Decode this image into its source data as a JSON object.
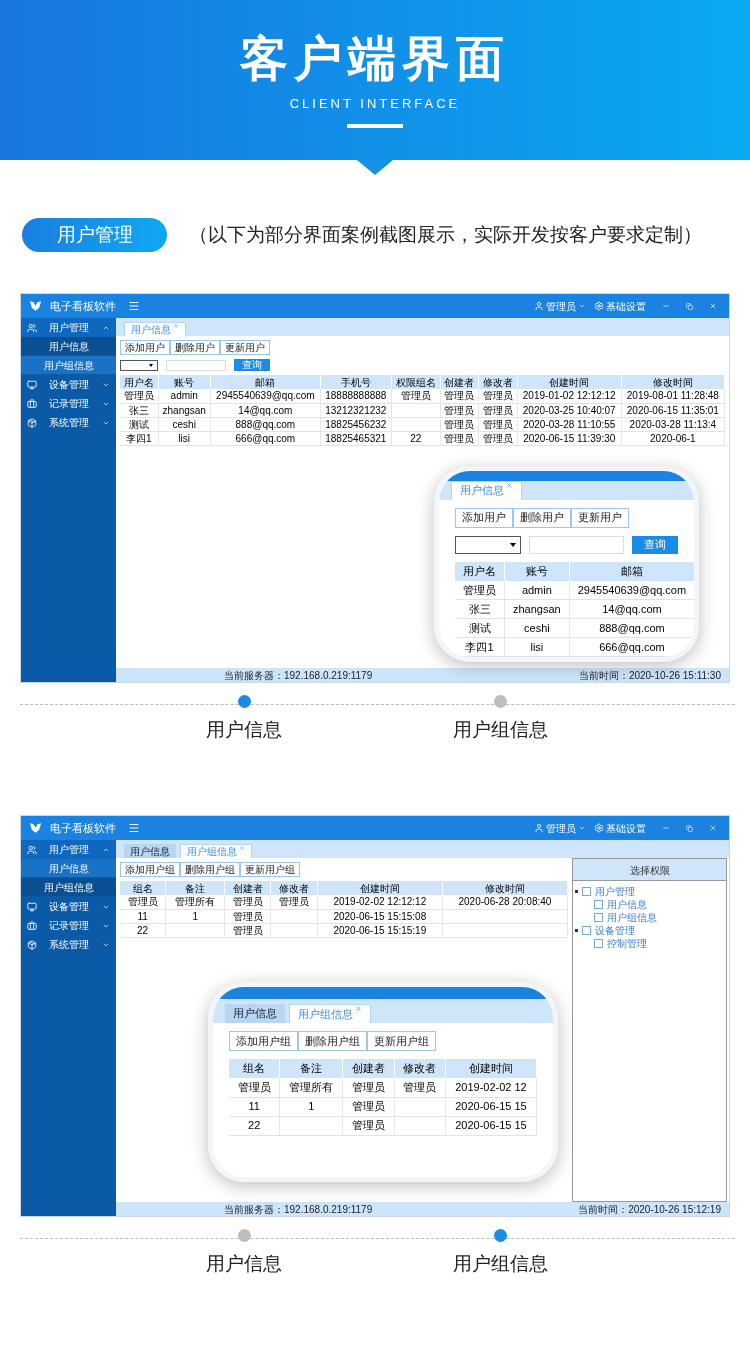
{
  "banner": {
    "title": "客户端界面",
    "subtitle": "CLIENT INTERFACE"
  },
  "section": {
    "label": "用户管理",
    "note": "（以下为部分界面案例截图展示，实际开发按客户要求定制）"
  },
  "screens": [
    {
      "app_title": "电子看板软件",
      "user": "管理员",
      "settings": "基础设置",
      "sidebar": [
        {
          "label": "用户管理",
          "expanded": true,
          "children": [
            {
              "label": "用户信息",
              "selected": true
            },
            {
              "label": "用户组信息",
              "selected": false
            }
          ]
        },
        {
          "label": "设备管理",
          "expanded": false
        },
        {
          "label": "记录管理",
          "expanded": false
        },
        {
          "label": "系统管理",
          "expanded": false
        }
      ],
      "tabs": [
        {
          "label": "用户信息",
          "selected": true
        }
      ],
      "buttons": [
        "添加用户",
        "删除用户",
        "更新用户"
      ],
      "search": {
        "button": "查询"
      },
      "table": {
        "columns": [
          "用户名",
          "账号",
          "邮箱",
          "手机号",
          "权限组名",
          "创建者",
          "修改者",
          "创建时间",
          "修改时间"
        ],
        "rows": [
          [
            "管理员",
            "admin",
            "2945540639@qq.com",
            "18888888888",
            "管理员",
            "管理员",
            "管理员",
            "2019-01-02 12:12:12",
            "2019-08-01 11:28:48"
          ],
          [
            "张三",
            "zhangsan",
            "14@qq.com",
            "13212321232",
            null,
            "管理员",
            "管理员",
            "2020-03-25 10:40:07",
            "2020-06-15 11:35:01"
          ],
          [
            "测试",
            "ceshi",
            "888@qq.com",
            "18825456232",
            null,
            "管理员",
            "管理员",
            "2020-03-28 11:10:55",
            "2020-03-28 11:13:4"
          ],
          [
            "李四1",
            "lisi",
            "666@qq.com",
            "18825465321",
            "22",
            "管理员",
            "管理员",
            "2020-06-15 11:39:30",
            "2020-06-1"
          ]
        ]
      },
      "status_bar": {
        "server": "当前服务器：192.168.0.219:1179",
        "time": "当前时间：2020-10-26 15:11:30"
      },
      "magnifier": {
        "tabs": [
          {
            "label": "用户信息",
            "selected": true
          }
        ],
        "buttons": [
          "添加用户",
          "删除用户",
          "更新用户"
        ],
        "search": {
          "button": "查询"
        },
        "table": {
          "columns": [
            "用户名",
            "账号",
            "邮箱"
          ],
          "rows": [
            [
              "管理员",
              "admin",
              "2945540639@qq.com"
            ],
            [
              "张三",
              "zhangsan",
              "14@qq.com"
            ],
            [
              "测试",
              "ceshi",
              "888@qq.com"
            ],
            [
              "李四1",
              "lisi",
              "666@qq.com"
            ]
          ]
        }
      },
      "pager": [
        {
          "label": "用户信息",
          "selected": true
        },
        {
          "label": "用户组信息",
          "selected": false
        }
      ]
    },
    {
      "app_title": "电子看板软件",
      "user": "管理员",
      "settings": "基础设置",
      "sidebar": [
        {
          "label": "用户管理",
          "expanded": true,
          "children": [
            {
              "label": "用户信息",
              "selected": false
            },
            {
              "label": "用户组信息",
              "selected": true
            }
          ]
        },
        {
          "label": "设备管理",
          "expanded": false
        },
        {
          "label": "记录管理",
          "expanded": false
        },
        {
          "label": "系统管理",
          "expanded": false
        }
      ],
      "tabs": [
        {
          "label": "用户信息",
          "selected": false
        },
        {
          "label": "用户组信息",
          "selected": true
        }
      ],
      "buttons": [
        "添加用户组",
        "删除用户组",
        "更新用户组"
      ],
      "table": {
        "columns": [
          "组名",
          "备注",
          "创建者",
          "修改者",
          "创建时间",
          "修改时间"
        ],
        "rows": [
          [
            "管理员",
            "管理所有",
            "管理员",
            "管理员",
            "2019-02-02 12:12:12",
            "2020-06-28 20:08:40"
          ],
          [
            "11",
            "1",
            "管理员",
            null,
            "2020-06-15 15:15:08",
            null
          ],
          [
            "22",
            null,
            "管理员",
            null,
            "2020-06-15 15:15:19",
            null
          ]
        ]
      },
      "tree": {
        "title": "选择权限",
        "items": [
          {
            "label": "用户管理",
            "checked": false,
            "children": [
              {
                "label": "用户信息",
                "checked": false
              },
              {
                "label": "用户组信息",
                "checked": false
              }
            ]
          },
          {
            "label": "设备管理",
            "checked": false,
            "children": [
              {
                "label": "控制管理",
                "checked": false
              }
            ]
          }
        ]
      },
      "status_bar": {
        "server": "当前服务器：192.168.0.219:1179",
        "time": "当前时间：2020-10-26 15:12:19"
      },
      "magnifier": {
        "tabs": [
          {
            "label": "用户信息",
            "selected": false
          },
          {
            "label": "用户组信息",
            "selected": true
          }
        ],
        "buttons": [
          "添加用户组",
          "删除用户组",
          "更新用户组"
        ],
        "table": {
          "columns": [
            "组名",
            "备注",
            "创建者",
            "修改者",
            "创建时间"
          ],
          "rows": [
            [
              "管理员",
              "管理所有",
              "管理员",
              "管理员",
              "2019-02-02 12"
            ],
            [
              "11",
              "1",
              "管理员",
              null,
              "2020-06-15 15"
            ],
            [
              "22",
              null,
              "管理员",
              null,
              "2020-06-15 15"
            ]
          ]
        }
      },
      "pager": [
        {
          "label": "用户信息",
          "selected": false
        },
        {
          "label": "用户组信息",
          "selected": true
        }
      ]
    }
  ]
}
